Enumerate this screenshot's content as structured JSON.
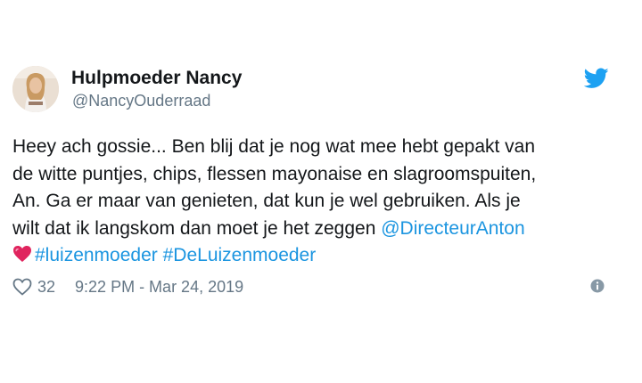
{
  "user": {
    "display_name": "Hulpmoeder Nancy",
    "handle": "@NancyOuderraad",
    "avatar_icon": "profile-photo"
  },
  "brand": {
    "icon": "twitter-bird-icon",
    "color": "#1da1f2"
  },
  "tweet": {
    "lines": [
      "Heey ach gossie... Ben blij dat je nog wat mee hebt gepakt van",
      "de witte puntjes, chips, flessen mayonaise en slagroomspuiten,",
      "An. Ga er maar van genieten, dat kun je wel gebruiken. Als je",
      "wilt dat ik langskom dan moet je het zeggen "
    ],
    "mention": "@DirecteurAnton",
    "emoji": "sparkling-heart-emoji",
    "hashtags": [
      "#luizenmoeder",
      "#DeLuizenmoeder"
    ],
    "link_color": "#1b95e0"
  },
  "footer": {
    "like_icon": "heart-outline-icon",
    "like_count": "32",
    "timestamp": "9:22 PM - Mar 24, 2019",
    "info_icon": "info-icon"
  }
}
